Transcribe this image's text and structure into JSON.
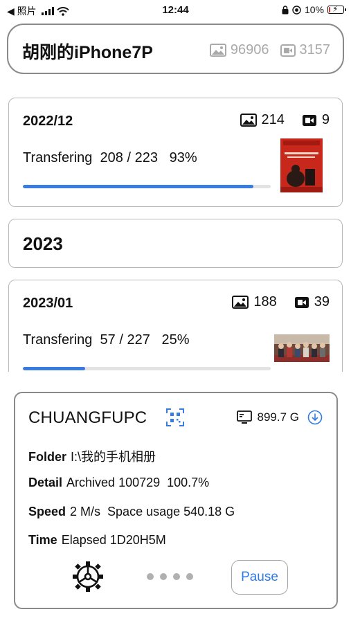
{
  "status_bar": {
    "back_app": "◀ 照片",
    "time": "12:44",
    "battery_percent": "10%",
    "battery_level": 0.1,
    "battery_color": "#e0322d"
  },
  "device": {
    "name": "胡刚的iPhone7P",
    "photo_count": "96906",
    "video_count": "3157"
  },
  "groups": [
    {
      "month": "2022/12",
      "photo_count": "214",
      "video_count": "9",
      "status": "Transfering",
      "progress": "208 / 223",
      "percent": "93%",
      "progress_value": 0.93,
      "thumbnail": "magazine-cover-thumbnail"
    },
    {
      "year": "2023"
    },
    {
      "month": "2023/01",
      "photo_count": "188",
      "video_count": "39",
      "status": "Transfering",
      "progress": "57 / 227",
      "percent": "25%",
      "progress_value": 0.25,
      "thumbnail": "group-photo-thumbnail"
    }
  ],
  "panel": {
    "pc_name": "CHUANGFUPC",
    "disk_free": "899.7 G",
    "folder_label": "Folder",
    "folder_value": "I:\\我的手机相册",
    "detail_label": "Detail",
    "detail_value": "Archived 100729  100.7%",
    "speed_label": "Speed",
    "speed_value": "2 M/s  Space usage 540.18 G",
    "time_label": "Time",
    "time_value": "Elapsed 1D20H5M",
    "pause_label": "Pause",
    "accent_color": "#2f7be6"
  }
}
